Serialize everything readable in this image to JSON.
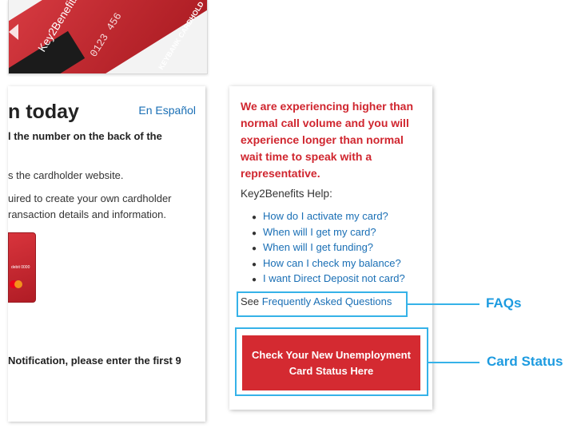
{
  "card_image": {
    "brand_text": "Key2Benefits",
    "number_text": "0123 456",
    "bank_text": "KEYBANK CARDHOLD"
  },
  "left_panel": {
    "heading": "n today",
    "espanol_link": "En Español",
    "line1": "l the number on the back of the",
    "line2": "s the cardholder website.",
    "line3": "uired to create your own cardholder",
    "line4": "ransaction details and information.",
    "line5": "Notification, please enter the first 9",
    "minicard_text": "debit 0000"
  },
  "right_panel": {
    "alert_text": "We are experiencing higher than normal call volume and you will experience longer than normal wait time to speak with a representative.",
    "help_title": "Key2Benefits Help:",
    "faq_links": [
      "How do I activate my card?",
      "When will I get my card?",
      "When will I get funding?",
      "How can I check my balance?",
      "I want Direct Deposit not card?"
    ],
    "see_prefix": "See",
    "faq_link": "Frequently Asked Questions",
    "status_button": "Check Your New Unemployment Card Status Here"
  },
  "annotations": {
    "faqs_label": "FAQs",
    "card_status_label": "Card Status",
    "color": "#35b2e8"
  },
  "colors": {
    "alert_red": "#d0262f",
    "button_red": "#d42a31",
    "link_blue": "#1a6fb5"
  }
}
